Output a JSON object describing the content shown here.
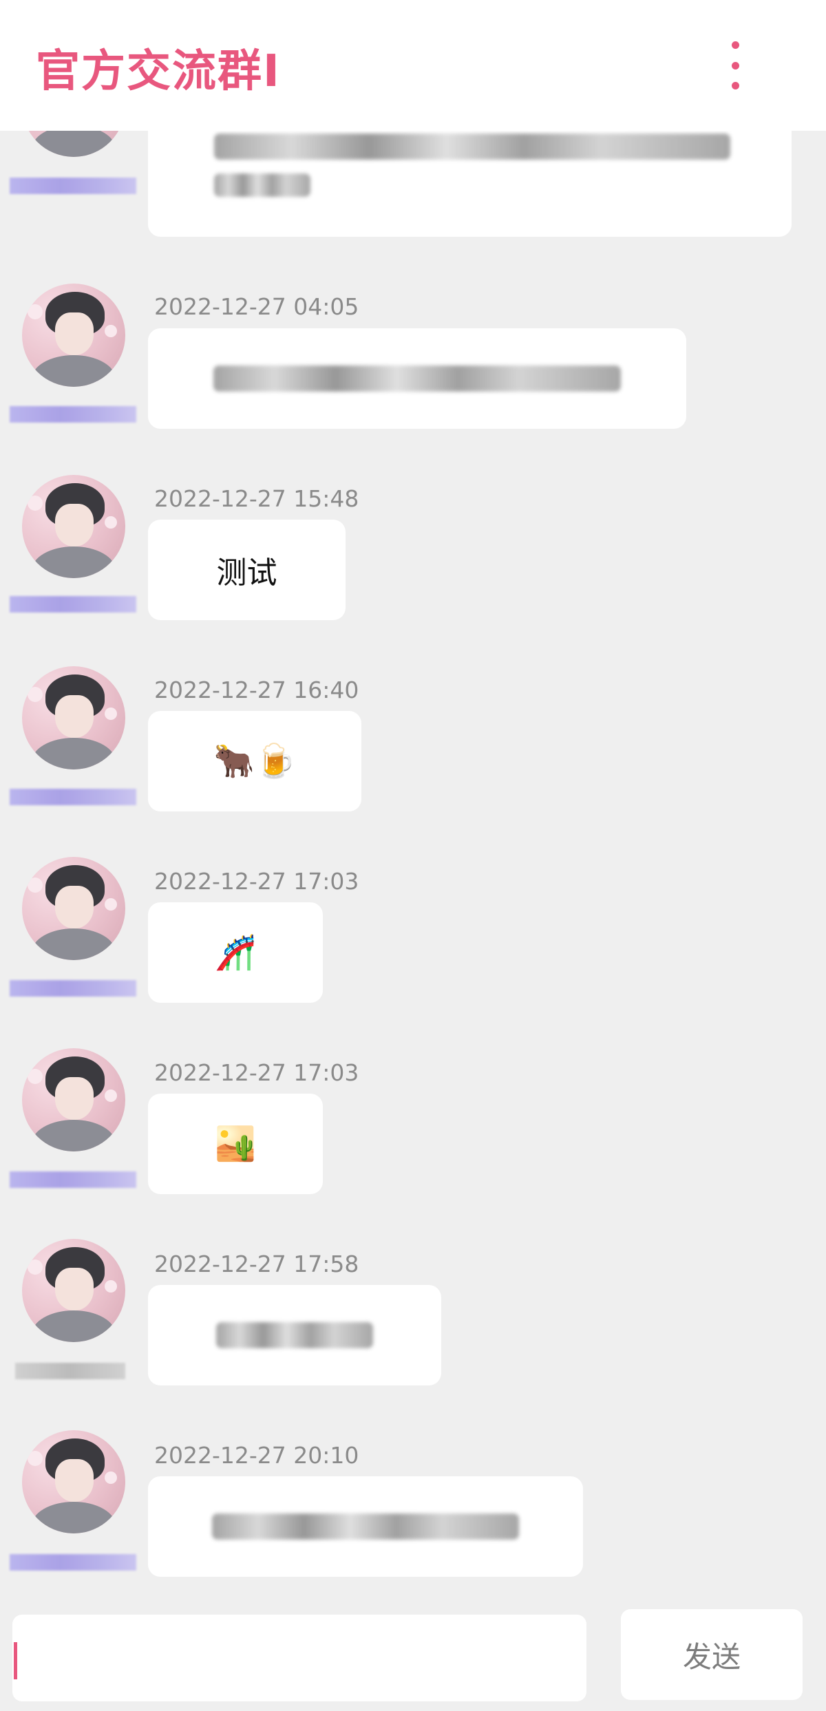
{
  "app": {
    "title": "官方交流群I",
    "accent_color": "#e8577e",
    "menu_icon": "more-vertical-icon"
  },
  "messages": [
    {
      "time": "2022-12-27 04:05",
      "content_type": "redacted-text",
      "text": ""
    },
    {
      "time": "2022-12-27 15:48",
      "content_type": "text",
      "text": "测试"
    },
    {
      "time": "2022-12-27 16:40",
      "content_type": "emoji",
      "text": "🐂🍺"
    },
    {
      "time": "2022-12-27 17:03",
      "content_type": "emoji",
      "text": "🎢"
    },
    {
      "time": "2022-12-27 17:03",
      "content_type": "emoji",
      "text": "🏜️"
    },
    {
      "time": "2022-12-27 17:58",
      "content_type": "redacted-text",
      "text": ""
    },
    {
      "time": "2022-12-27 20:10",
      "content_type": "redacted-text",
      "text": ""
    }
  ],
  "composer": {
    "input_value": "",
    "send_label": "发送"
  }
}
